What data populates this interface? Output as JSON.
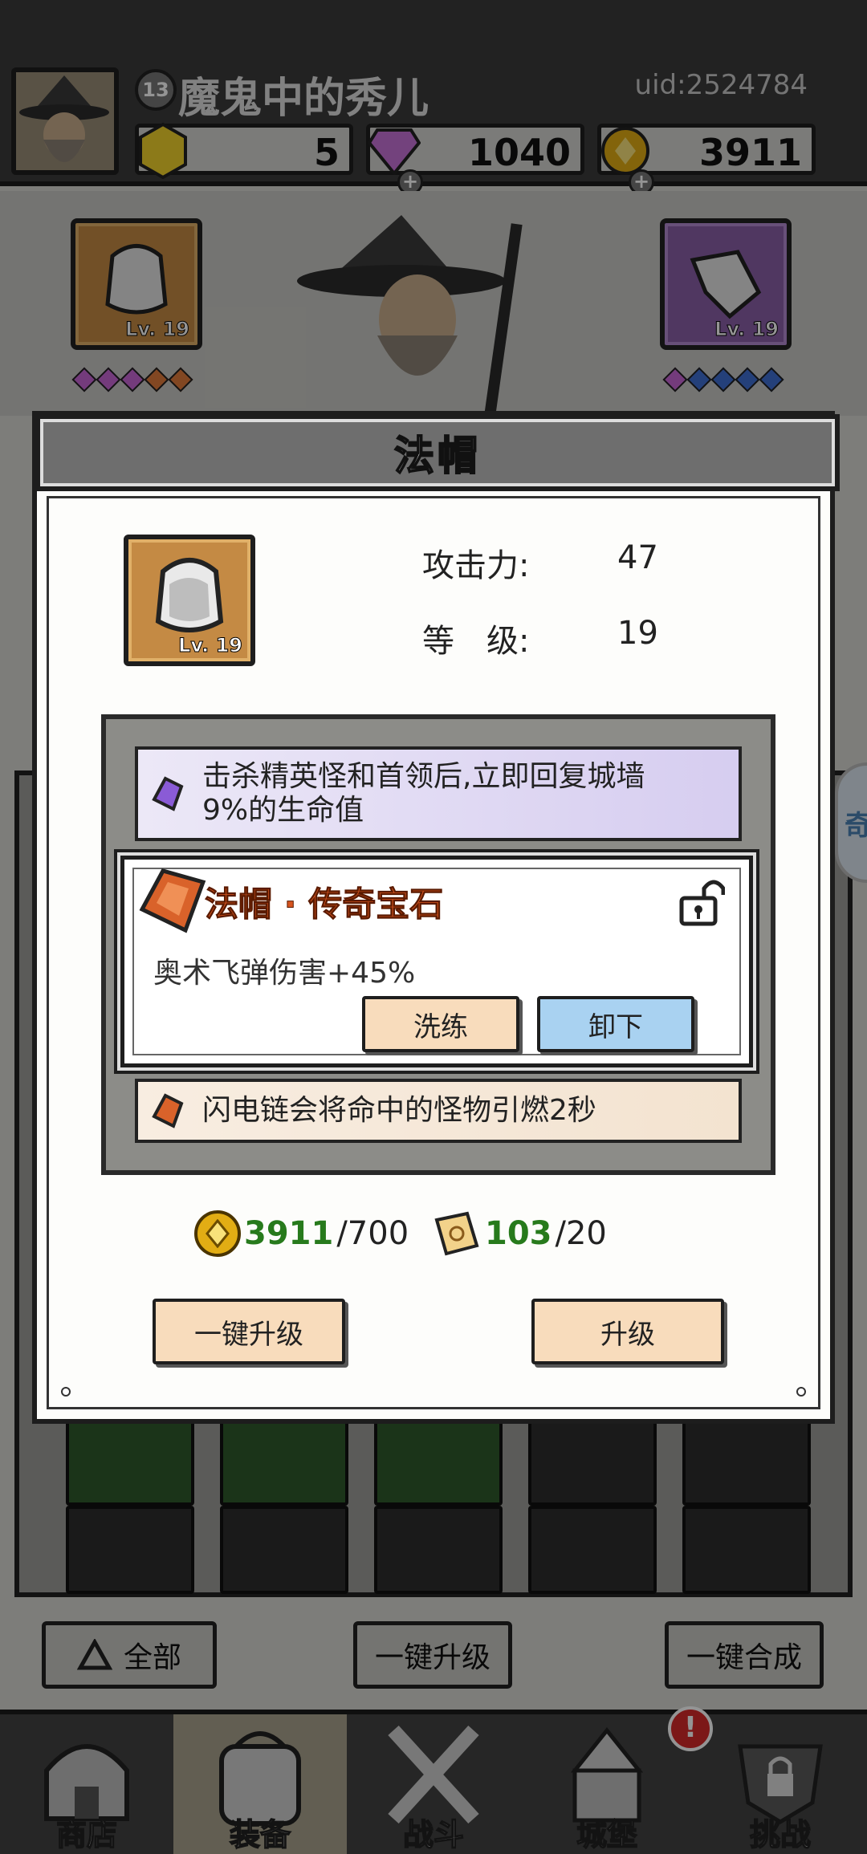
{
  "player": {
    "level": "13",
    "name": "魔鬼中的秀儿",
    "uid": "uid:2524784"
  },
  "resources": [
    {
      "icon": "yellow-gem-icon",
      "value": "5"
    },
    {
      "icon": "purple-diamond-icon",
      "value": "1040"
    },
    {
      "icon": "gold-coin-icon",
      "value": "3911"
    }
  ],
  "equipment": {
    "left_slot_level": "Lv. 19",
    "right_slot_level": "Lv. 19"
  },
  "modal": {
    "title": "法帽",
    "item_level_badge": "Lv. 19",
    "stats": [
      {
        "label": "攻击力:",
        "value": "47"
      },
      {
        "label": "等　级:",
        "value": "19"
      }
    ],
    "gem_slots": {
      "top_desc_line1": "击杀精英怪和首领后,立即回复城墙",
      "top_desc_line2": "9%的生命值",
      "card_title": "法帽 · 传奇宝石",
      "card_desc": "奥术飞弹伤害+45%",
      "reroll_button": "洗练",
      "unequip_button": "卸下",
      "bottom_desc": "闪电链会将命中的怪物引燃2秒"
    },
    "costs": [
      {
        "icon": "gold-coin-icon",
        "have": "3911",
        "need": "/700"
      },
      {
        "icon": "scroll-icon",
        "have": "103",
        "need": "/20"
      }
    ],
    "one_click_upgrade": "一键升级",
    "upgrade": "升级"
  },
  "bag_toolbar": {
    "filter": "全部",
    "one_click_upgrade": "一键升级",
    "one_click_merge": "一键合成"
  },
  "side_tab": "奇",
  "nav": [
    {
      "label": "商店",
      "icon": "shop-icon"
    },
    {
      "label": "装备",
      "icon": "backpack-icon"
    },
    {
      "label": "战斗",
      "icon": "crossed-swords-icon"
    },
    {
      "label": "城堡",
      "icon": "castle-icon"
    },
    {
      "label": "挑战",
      "icon": "locked-challenge-icon"
    }
  ],
  "nav_alert": "!",
  "colors": {
    "accent_orange": "#d6541f",
    "have_green": "#277a1c",
    "button_peach": "#f8dcbc",
    "button_blue": "#a9d2f1"
  }
}
